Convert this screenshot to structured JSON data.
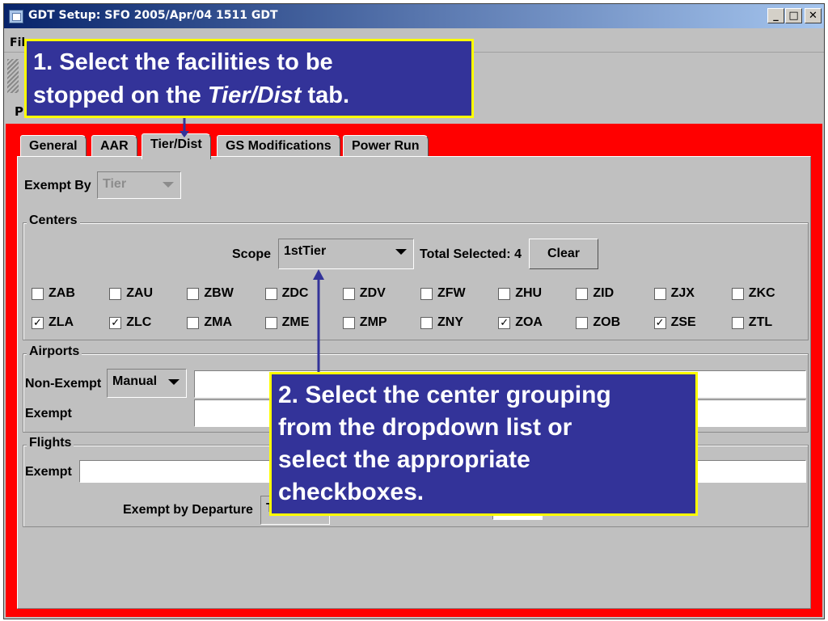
{
  "window": {
    "title": "GDT Setup: SFO 2005/Apr/04 1511 GDT",
    "minimize": "_",
    "maximize": "□",
    "close": "✕"
  },
  "menu": {
    "first_item": "Fil"
  },
  "partial_label": "P",
  "tabs": [
    "General",
    "AAR",
    "Tier/Dist",
    "GS Modifications",
    "Power Run"
  ],
  "active_tab": "Tier/Dist",
  "exempt_by": {
    "label": "Exempt By",
    "value": "Tier"
  },
  "centers": {
    "title": "Centers",
    "scope_label": "Scope",
    "scope_value": "1stTier",
    "total_selected": "Total Selected: 4",
    "clear_label": "Clear",
    "checkboxes": [
      {
        "label": "ZAB",
        "checked": false
      },
      {
        "label": "ZAU",
        "checked": false
      },
      {
        "label": "ZBW",
        "checked": false
      },
      {
        "label": "ZDC",
        "checked": false
      },
      {
        "label": "ZDV",
        "checked": false
      },
      {
        "label": "ZFW",
        "checked": false
      },
      {
        "label": "ZHU",
        "checked": false
      },
      {
        "label": "ZID",
        "checked": false
      },
      {
        "label": "ZJX",
        "checked": false
      },
      {
        "label": "ZKC",
        "checked": false
      },
      {
        "label": "ZLA",
        "checked": true
      },
      {
        "label": "ZLC",
        "checked": true
      },
      {
        "label": "ZMA",
        "checked": false
      },
      {
        "label": "ZME",
        "checked": false
      },
      {
        "label": "ZMP",
        "checked": false
      },
      {
        "label": "ZNY",
        "checked": false
      },
      {
        "label": "ZOA",
        "checked": true
      },
      {
        "label": "ZOB",
        "checked": false
      },
      {
        "label": "ZSE",
        "checked": true
      },
      {
        "label": "ZTL",
        "checked": false
      }
    ]
  },
  "airports": {
    "title": "Airports",
    "non_exempt_label": "Non-Exempt",
    "non_exempt_mode": "Manual",
    "exempt_label": "Exempt"
  },
  "flights": {
    "title": "Flights",
    "exempt_label": "Exempt",
    "exempt_by_departure_label": "Exempt by Departure",
    "exempt_by_departure_value": "T"
  },
  "callouts": {
    "one": {
      "line1": "1. Select the facilities to be",
      "line2_a": "stopped on the ",
      "line2_b": "Tier/Dist",
      "line2_c": " tab."
    },
    "two": {
      "line1": "2. Select the center grouping",
      "line2": "from the dropdown list or",
      "line3": "select the appropriate",
      "line4": "checkboxes."
    }
  },
  "colors": {
    "highlight_frame": "#ff0000",
    "callout_fill": "#333399",
    "callout_border": "#ffff00",
    "arrow": "#333399"
  }
}
